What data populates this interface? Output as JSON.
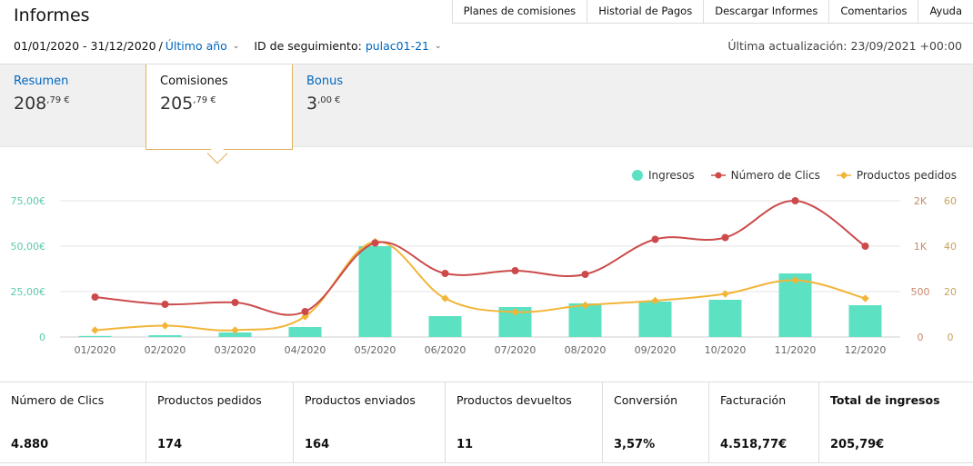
{
  "header": {
    "title": "Informes"
  },
  "topnav": [
    "Planes de comisiones",
    "Historial de Pagos",
    "Descargar Informes",
    "Comentarios",
    "Ayuda"
  ],
  "filters": {
    "date_range": "01/01/2020 - 31/12/2020",
    "separator": "/",
    "period": "Último año",
    "tracking_label": "ID de seguimiento:",
    "tracking_id": "pulac01-21",
    "last_updated": "Última actualización: 23/09/2021 +00:00"
  },
  "tabs": [
    {
      "label": "Resumen",
      "value_int": "208",
      "value_dec": ",79 €"
    },
    {
      "label": "Comisiones",
      "value_int": "205",
      "value_dec": ",79 €"
    },
    {
      "label": "Bonus",
      "value_int": "3",
      "value_dec": ",00 €"
    }
  ],
  "chart_data": {
    "type": "bar",
    "categories": [
      "01/2020",
      "02/2020",
      "03/2020",
      "04/2020",
      "05/2020",
      "06/2020",
      "07/2020",
      "08/2020",
      "09/2020",
      "10/2020",
      "11/2020",
      "12/2020"
    ],
    "series": [
      {
        "name": "Ingresos",
        "type": "bar",
        "axis": "left",
        "color": "#5ce1c2",
        "values": [
          0.6,
          1.0,
          2.5,
          5.5,
          50.0,
          11.5,
          16.5,
          18.5,
          19.5,
          20.5,
          35.0,
          17.5
        ]
      },
      {
        "name": "Número de Clics",
        "type": "line",
        "axis": "right-clicks",
        "color": "#cc4a4a",
        "values": [
          440,
          360,
          380,
          280,
          1070,
          700,
          730,
          690,
          1150,
          1190,
          2010,
          1000
        ]
      },
      {
        "name": "Productos pedidos",
        "type": "line",
        "axis": "right-products",
        "color": "#f2b538",
        "values": [
          3,
          5,
          3,
          9,
          42,
          17,
          11,
          14,
          16,
          19,
          25,
          17
        ]
      }
    ],
    "axes": {
      "left": {
        "ticks": [
          "0",
          "25,00€",
          "50,00€",
          "75,00€"
        ],
        "ylim": [
          0,
          75
        ]
      },
      "right_clicks": {
        "ticks": [
          "0",
          "500",
          "1K",
          "2K"
        ]
      },
      "right_products": {
        "ticks": [
          "0",
          "20",
          "40",
          "60"
        ],
        "ylim": [
          0,
          60
        ]
      }
    },
    "grid": true,
    "legend_position": "top-right"
  },
  "metrics": [
    {
      "label": "Número de Clics",
      "value": "4.880"
    },
    {
      "label": "Productos pedidos",
      "value": "174"
    },
    {
      "label": "Productos enviados",
      "value": "164"
    },
    {
      "label": "Productos devueltos",
      "value": "11"
    },
    {
      "label": "Conversión",
      "value": "3,57%"
    },
    {
      "label": "Facturación",
      "value": "4.518,77€"
    },
    {
      "label": "Total de ingresos",
      "value": "205,79€"
    }
  ]
}
